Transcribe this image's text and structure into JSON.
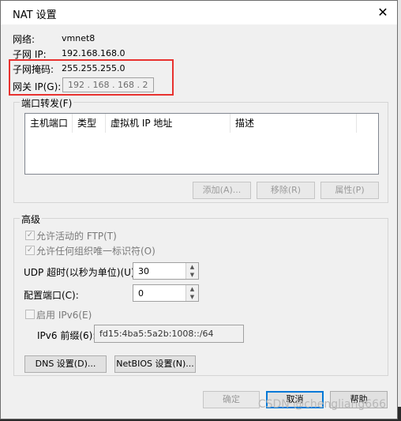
{
  "window": {
    "title": "NAT 设置",
    "close_glyph": "✕"
  },
  "info": {
    "network_label": "网络:",
    "network_value": "vmnet8",
    "subnet_ip_label": "子网 IP:",
    "subnet_ip_value": "192.168.168.0",
    "subnet_mask_label": "子网掩码:",
    "subnet_mask_value": "255.255.255.0",
    "gateway_label": "网关 IP(G):",
    "gateway_value": "192 . 168 . 168 .  2"
  },
  "port_forwarding": {
    "legend": "端口转发(F)",
    "columns": [
      "主机端口",
      "类型",
      "虚拟机 IP 地址",
      "描述"
    ],
    "add_label": "添加(A)...",
    "remove_label": "移除(R)",
    "properties_label": "属性(P)"
  },
  "advanced": {
    "legend": "高级",
    "allow_ftp": "允许活动的 FTP(T)",
    "allow_any_uid": "允许任何组织唯一标识符(O)",
    "udp_timeout_label": "UDP 超时(以秒为单位)(U):",
    "udp_timeout_value": "30",
    "config_port_label": "配置端口(C):",
    "config_port_value": "0",
    "enable_ipv6": "启用 IPv6(E)",
    "ipv6_prefix_label": "IPv6 前缀(6):",
    "ipv6_prefix_value": "fd15:4ba5:5a2b:1008::/64",
    "dns_button": "DNS 设置(D)...",
    "netbios_button": "NetBIOS 设置(N)..."
  },
  "footer": {
    "ok": "确定",
    "cancel": "取消",
    "help": "帮助"
  },
  "watermark": "CSDN @chengliang666",
  "colors": {
    "highlight_box": "#e8322f",
    "focus_blue": "#0078d7"
  }
}
